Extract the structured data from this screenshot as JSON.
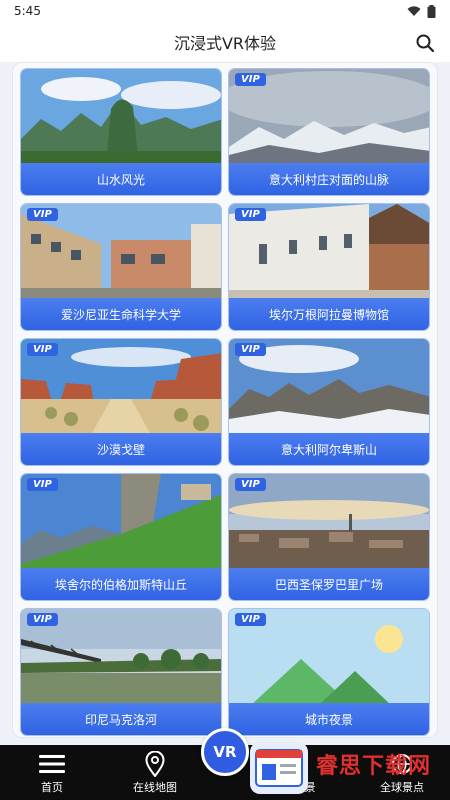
{
  "status": {
    "time": "5:45"
  },
  "header": {
    "title": "沉浸式VR体验"
  },
  "cards": [
    {
      "title": "山水风光",
      "vip": ""
    },
    {
      "title": "意大利村庄对面的山脉",
      "vip": "VIP"
    },
    {
      "title": "爱沙尼亚生命科学大学",
      "vip": "VIP"
    },
    {
      "title": "埃尔万根阿拉曼博物馆",
      "vip": "VIP"
    },
    {
      "title": "沙漠戈壁",
      "vip": "VIP"
    },
    {
      "title": "意大利阿尔卑斯山",
      "vip": "VIP"
    },
    {
      "title": "埃舍尔的伯格加斯特山丘",
      "vip": "VIP"
    },
    {
      "title": "巴西圣保罗巴里广场",
      "vip": "VIP"
    },
    {
      "title": "印尼马克洛河",
      "vip": "VIP"
    },
    {
      "title": "城市夜景",
      "vip": "VIP"
    }
  ],
  "tabs": [
    {
      "label": "首页",
      "icon": "menu-icon"
    },
    {
      "label": "在线地图",
      "icon": "map-pin-icon"
    },
    {
      "label": "VR"
    },
    {
      "label": "景",
      "icon": ""
    },
    {
      "label": "全球景点",
      "icon": "globe-icon"
    }
  ],
  "watermark": {
    "text": "睿思下载网"
  },
  "colors": {
    "accent": "#2f63e2",
    "tab_bg": "#0d0d0d"
  }
}
